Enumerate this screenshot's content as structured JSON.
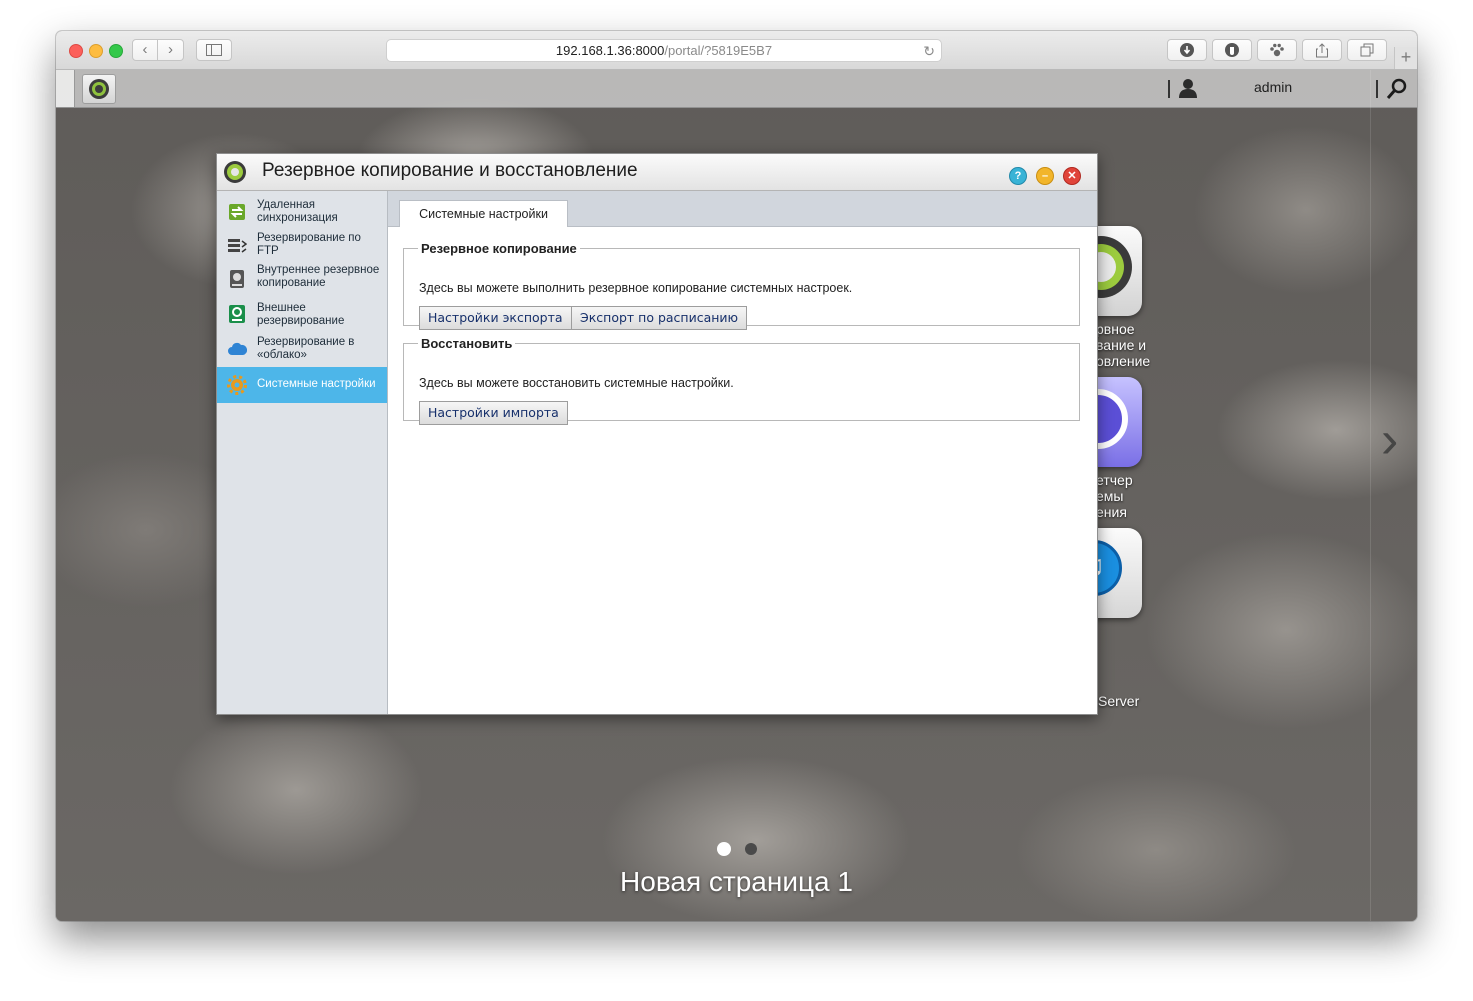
{
  "browser": {
    "url_host": "192.168.1.36:8000",
    "url_path": "/portal/?5819E5B7",
    "back_icon": "chevron-left-icon",
    "forward_icon": "chevron-right-icon",
    "sidebar_icon": "sidebar-toggle-icon",
    "reload_icon": "reload-icon",
    "new_tab_symbol": "+"
  },
  "topbar": {
    "user": "admin",
    "user_icon": "user-icon",
    "search_icon": "search-icon"
  },
  "dialog": {
    "title": "Резервное копирование и восстановление",
    "help_symbol": "?",
    "minimize_symbol": "–",
    "close_symbol": "✕"
  },
  "sidebar": {
    "items": [
      {
        "label": "Удаленная синхронизация",
        "icon": "remote-sync-icon",
        "active": false
      },
      {
        "label": "Резервирование по FTP",
        "icon": "ftp-backup-icon",
        "active": false
      },
      {
        "label": "Внутреннее резервное копирование",
        "icon": "internal-backup-icon",
        "active": false
      },
      {
        "label": "Внешнее резервирование",
        "icon": "external-backup-icon",
        "active": false
      },
      {
        "label": "Резервирование в «облако»",
        "icon": "cloud-icon",
        "active": false
      },
      {
        "label": "Системные настройки",
        "icon": "gear-icon",
        "active": true
      }
    ]
  },
  "content": {
    "tab": "Системные настройки",
    "backup": {
      "legend": "Резервное копирование",
      "description": "Здесь вы можете выполнить резервное копирование системных настроек.",
      "export_button": "Настройки экспорта",
      "schedule_button": "Экспорт по расписанию"
    },
    "restore": {
      "legend": "Восстановить",
      "description": "Здесь вы можете восстановить системные настройки.",
      "import_button": "Настройки импорта"
    }
  },
  "desktop": {
    "apps": [
      {
        "label_line1": "рвное",
        "label_line2": "вание и",
        "label_line3": "овление"
      },
      {
        "label_line1": "етчер",
        "label_line2": "емы",
        "label_line3": "ения"
      },
      {
        "label_line1": "Server",
        "label_line2": "",
        "label_line3": ""
      }
    ],
    "page_title": "Новая страница 1",
    "page_count": 2,
    "active_page": 1
  },
  "colors": {
    "accent": "#4db6e9",
    "sidebar_bg": "#dfe3e8",
    "button_text": "#17306b"
  }
}
